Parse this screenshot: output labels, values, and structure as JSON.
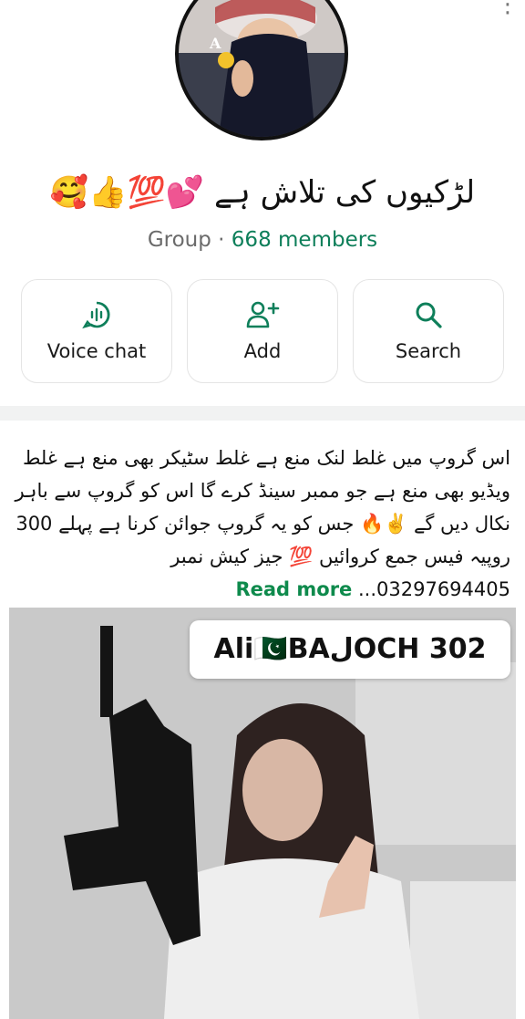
{
  "group": {
    "name": "لڑکیوں کی تلاش ہے 💕💯👍🥰",
    "type": "Group",
    "separator": "·",
    "members": "668 members"
  },
  "avatar": {
    "badge_letter": "A"
  },
  "actions": [
    {
      "label": "Voice chat",
      "icon": "voice-chat-icon"
    },
    {
      "label": "Add",
      "icon": "add-person-icon"
    },
    {
      "label": "Search",
      "icon": "search-icon"
    }
  ],
  "description": {
    "text": "اس گروپ میں غلط لنک منع ہے غلط سٹیکر بھی منع ہے غلط ویڈیو بھی منع ہے جو ممبر سینڈ کرے گا اس کو گروپ سے باہر نکال دیں گے ✌️🔥 جس کو یہ گروپ جوائن کرنا ہے پہلے 300 روپیہ فیس جمع کروائیں 💯 جیز کیش نمبر 03297694405...",
    "read_more": "Read more"
  },
  "post": {
    "caption": "Ali🇵🇰BAلOCH 302"
  },
  "colors": {
    "accent": "#0e7f5a",
    "read_more": "#0e8a4c",
    "divider": "#f1f2f2"
  }
}
